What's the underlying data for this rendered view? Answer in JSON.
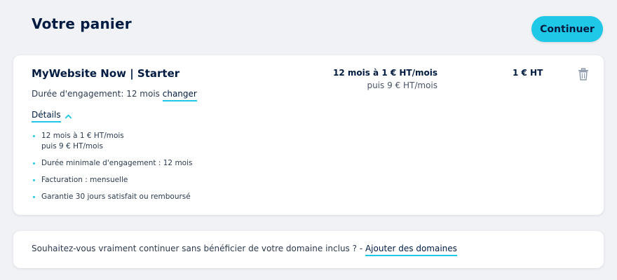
{
  "header": {
    "title": "Votre panier",
    "continue_label": "Continuer"
  },
  "cart_item": {
    "name": "MyWebsite Now | Starter",
    "engagement_label": "Durée d'engagement: 12 mois",
    "change_link": "changer",
    "details_label": "Détails",
    "details": {
      "line1a": "12 mois à 1 € HT/mois",
      "line1b": "puis 9 € HT/mois",
      "line2": "Durée minimale d'engagement : 12 mois",
      "line3": "Facturation : mensuelle",
      "line4": "Garantie 30 jours satisfait ou remboursé"
    },
    "price_main": "12 mois à 1 € HT/mois",
    "price_sub": "puis 9 € HT/mois",
    "total": "1 € HT",
    "delete_icon": "trash-icon"
  },
  "domain_notice": {
    "text": "Souhaitez-vous vraiment continuer sans bénéficier de votre domaine inclus ? - ",
    "link": "Ajouter des domaines"
  },
  "colors": {
    "accent": "#1ec8e6",
    "text": "#001b41",
    "background": "#f0f2f5"
  }
}
